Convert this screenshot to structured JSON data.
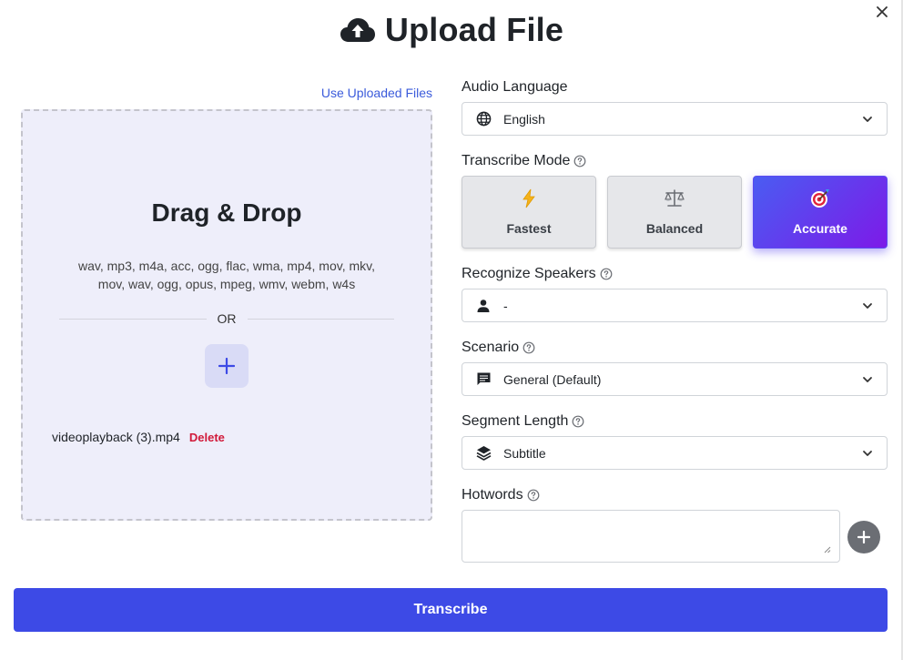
{
  "header": {
    "title": "Upload File"
  },
  "upload": {
    "use_uploaded_label": "Use Uploaded Files",
    "drag_drop_title": "Drag & Drop",
    "formats_line1": "wav, mp3, m4a, acc, ogg, flac, wma, mp4, mov, mkv,",
    "formats_line2": "mov, wav, ogg, opus, mpeg, wmv, webm, w4s",
    "or_label": "OR",
    "file_name": "videoplayback (3).mp4",
    "delete_label": "Delete"
  },
  "form": {
    "audio_language": {
      "label": "Audio Language",
      "value": "English",
      "icon": "globe-icon"
    },
    "transcribe_mode": {
      "label": "Transcribe Mode",
      "options": [
        {
          "label": "Fastest",
          "icon": "lightning-icon"
        },
        {
          "label": "Balanced",
          "icon": "scale-icon"
        },
        {
          "label": "Accurate",
          "icon": "target-icon"
        }
      ],
      "selected": "Accurate"
    },
    "recognize_speakers": {
      "label": "Recognize Speakers",
      "value": "-",
      "icon": "person-icon"
    },
    "scenario": {
      "label": "Scenario",
      "value": "General (Default)",
      "icon": "message-icon"
    },
    "segment_length": {
      "label": "Segment Length",
      "value": "Subtitle",
      "icon": "layers-icon"
    },
    "hotwords": {
      "label": "Hotwords",
      "value": ""
    }
  },
  "actions": {
    "transcribe_label": "Transcribe"
  },
  "colors": {
    "primary": "#3d4ae6",
    "link": "#3b5bdb",
    "delete": "#d11a3a",
    "accent_gradient_start": "#4a5cf2",
    "accent_gradient_end": "#7d1ae8"
  }
}
